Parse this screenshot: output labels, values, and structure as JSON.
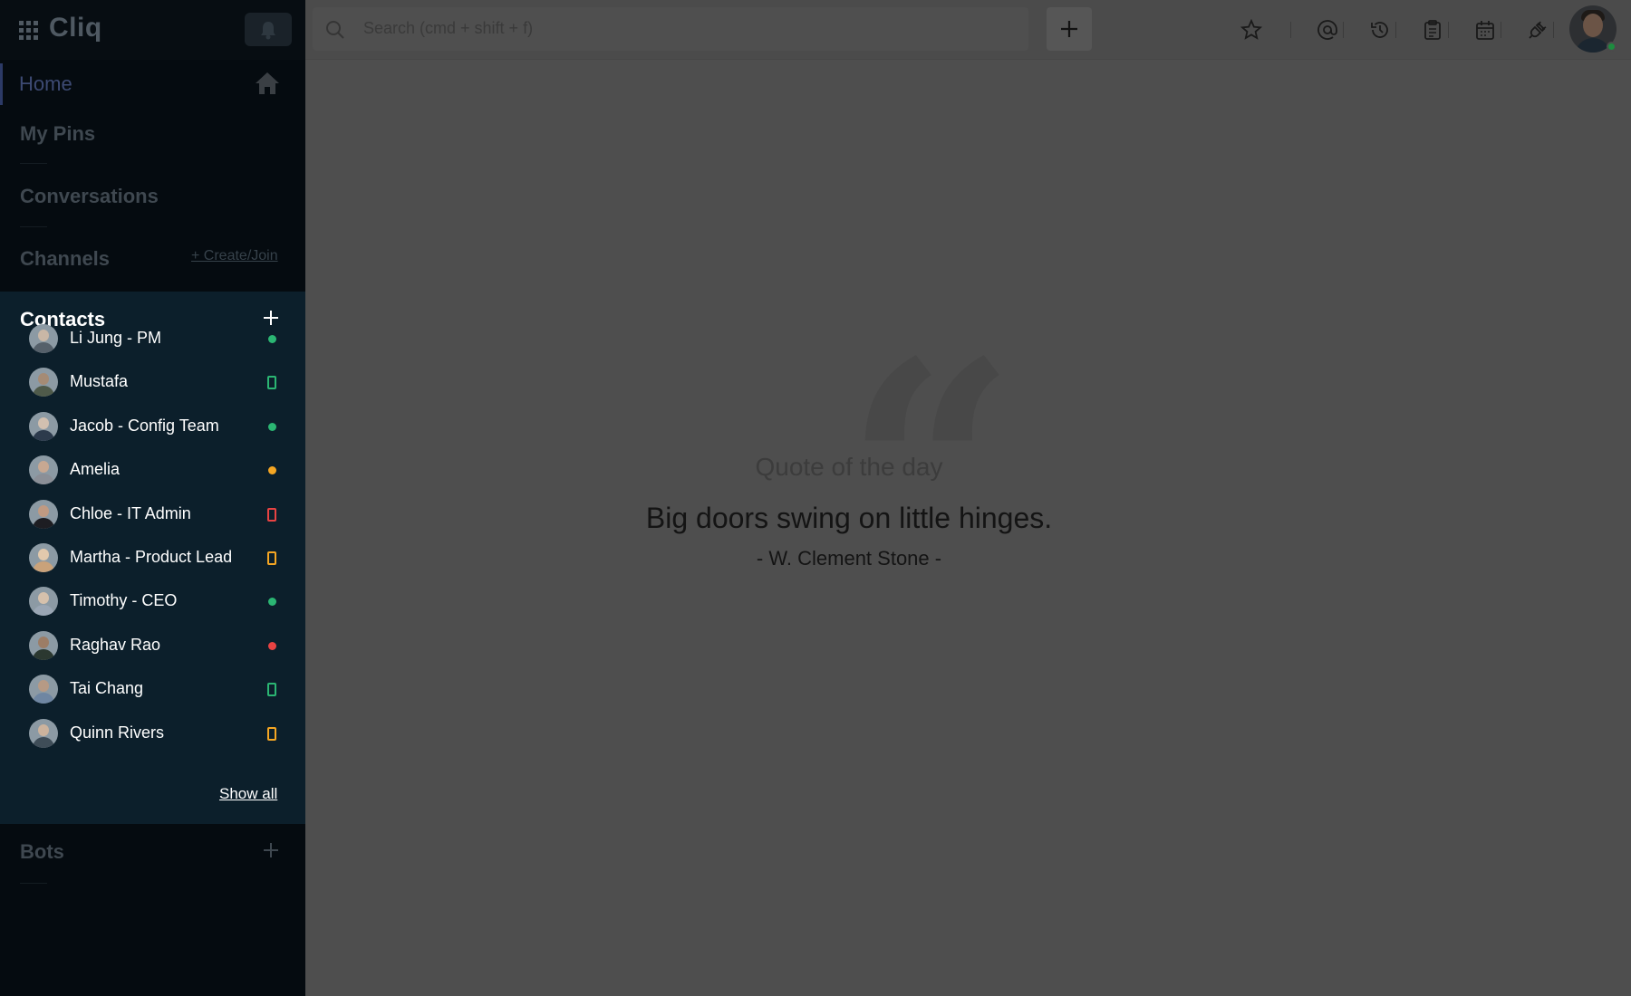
{
  "app": {
    "name": "Cliq"
  },
  "sidebar": {
    "home": "Home",
    "my_pins": "My Pins",
    "conversations": "Conversations",
    "channels": "Channels",
    "create_join": "+ Create/Join",
    "contacts_title": "Contacts",
    "bots": "Bots",
    "show_all": "Show all"
  },
  "contacts": [
    {
      "name": "Li Jung - PM",
      "status": "online",
      "status_type": "dot",
      "color": "#2bb673"
    },
    {
      "name": "Mustafa",
      "status": "mobile-online",
      "status_type": "mobile",
      "color": "#2bb673"
    },
    {
      "name": "Jacob - Config Team",
      "status": "online",
      "status_type": "dot",
      "color": "#2bb673"
    },
    {
      "name": "Amelia",
      "status": "away",
      "status_type": "dot",
      "color": "#f5a623"
    },
    {
      "name": "Chloe - IT Admin",
      "status": "mobile-busy",
      "status_type": "mobile",
      "color": "#e94343"
    },
    {
      "name": "Martha -  Product Lead",
      "status": "mobile-away",
      "status_type": "mobile",
      "color": "#f5a623"
    },
    {
      "name": "Timothy - CEO",
      "status": "online",
      "status_type": "dot",
      "color": "#2bb673"
    },
    {
      "name": "Raghav Rao",
      "status": "busy",
      "status_type": "dot",
      "color": "#e94343"
    },
    {
      "name": "Tai Chang",
      "status": "mobile-online",
      "status_type": "mobile",
      "color": "#2bb673"
    },
    {
      "name": "Quinn Rivers",
      "status": "mobile-away",
      "status_type": "mobile",
      "color": "#f5a623"
    }
  ],
  "topbar": {
    "search_placeholder": "Search (cmd + shift + f)",
    "icons": [
      "star-icon",
      "mention-icon",
      "history-icon",
      "clipboard-icon",
      "calendar-icon",
      "plug-icon"
    ]
  },
  "quote": {
    "heading": "Quote of the day",
    "text": "Big doors swing on little hinges.",
    "author": "- W. Clement Stone -"
  },
  "colors": {
    "sidebar_bg": "#050b10",
    "contacts_bg": "#0c1f2b",
    "main_bg": "#4e4e4e",
    "online": "#2bb673",
    "away": "#f5a623",
    "busy": "#e94343"
  }
}
